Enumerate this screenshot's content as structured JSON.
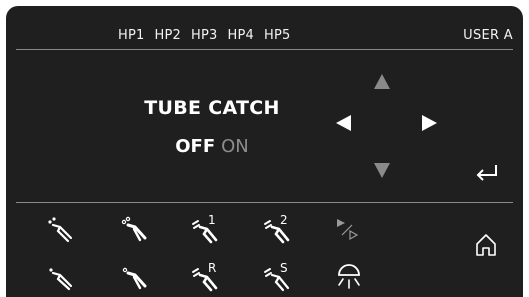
{
  "header": {
    "hp_tabs": [
      "HP1",
      "HP2",
      "HP3",
      "HP4",
      "HP5"
    ],
    "user_label": "USER A"
  },
  "main": {
    "title": "TUBE CATCH",
    "toggle": {
      "off_label": "OFF",
      "on_label": "ON",
      "selected": "OFF"
    }
  },
  "icons": {
    "handpiece_1_superscript": "1",
    "handpiece_2_superscript": "2",
    "handpiece_r_superscript": "R",
    "handpiece_s_superscript": "S"
  },
  "colors": {
    "background": "#1f1f1f",
    "text": "#f2f2f2",
    "inactive": "#8a8a8a"
  }
}
